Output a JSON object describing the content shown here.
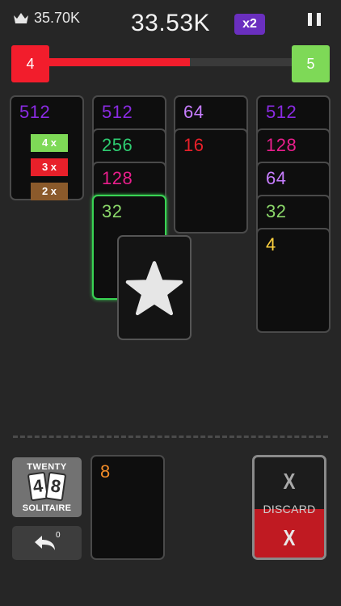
{
  "hud": {
    "best_score": "35.70K",
    "score": "33.53K",
    "multiplier": "x2"
  },
  "level": {
    "current": "4",
    "next": "5",
    "progress": 0.58
  },
  "colors": {
    "512": "#8a2be2",
    "256": "#2ecc71",
    "128": "#e91e8c",
    "64": "#c77dff",
    "32": "#8bd86a",
    "16": "#e8202a",
    "8": "#f28c28",
    "4": "#ffd23f"
  },
  "columns": [
    {
      "cards": [
        "512"
      ]
    },
    {
      "cards": [
        "512",
        "256",
        "128",
        "32"
      ]
    },
    {
      "cards": [
        "64",
        "16"
      ]
    },
    {
      "cards": [
        "512",
        "128",
        "64",
        "32",
        "4"
      ]
    }
  ],
  "streak_hints": [
    {
      "label": "4 x",
      "color": "#7ed957"
    },
    {
      "label": "3 x",
      "color": "#e8202a"
    },
    {
      "label": "2 x",
      "color": "#8b5a2b"
    }
  ],
  "held_card": {
    "icon": "star-icon"
  },
  "logo": {
    "top_text": "TWENTY",
    "digit_1": "4",
    "digit_2": "8",
    "bottom_text": "SOLITAIRE"
  },
  "undo": {
    "count": "0"
  },
  "next_card": {
    "value": "8"
  },
  "discard": {
    "label": "DISCARD",
    "mark_top": "X",
    "mark_bottom": "X"
  }
}
